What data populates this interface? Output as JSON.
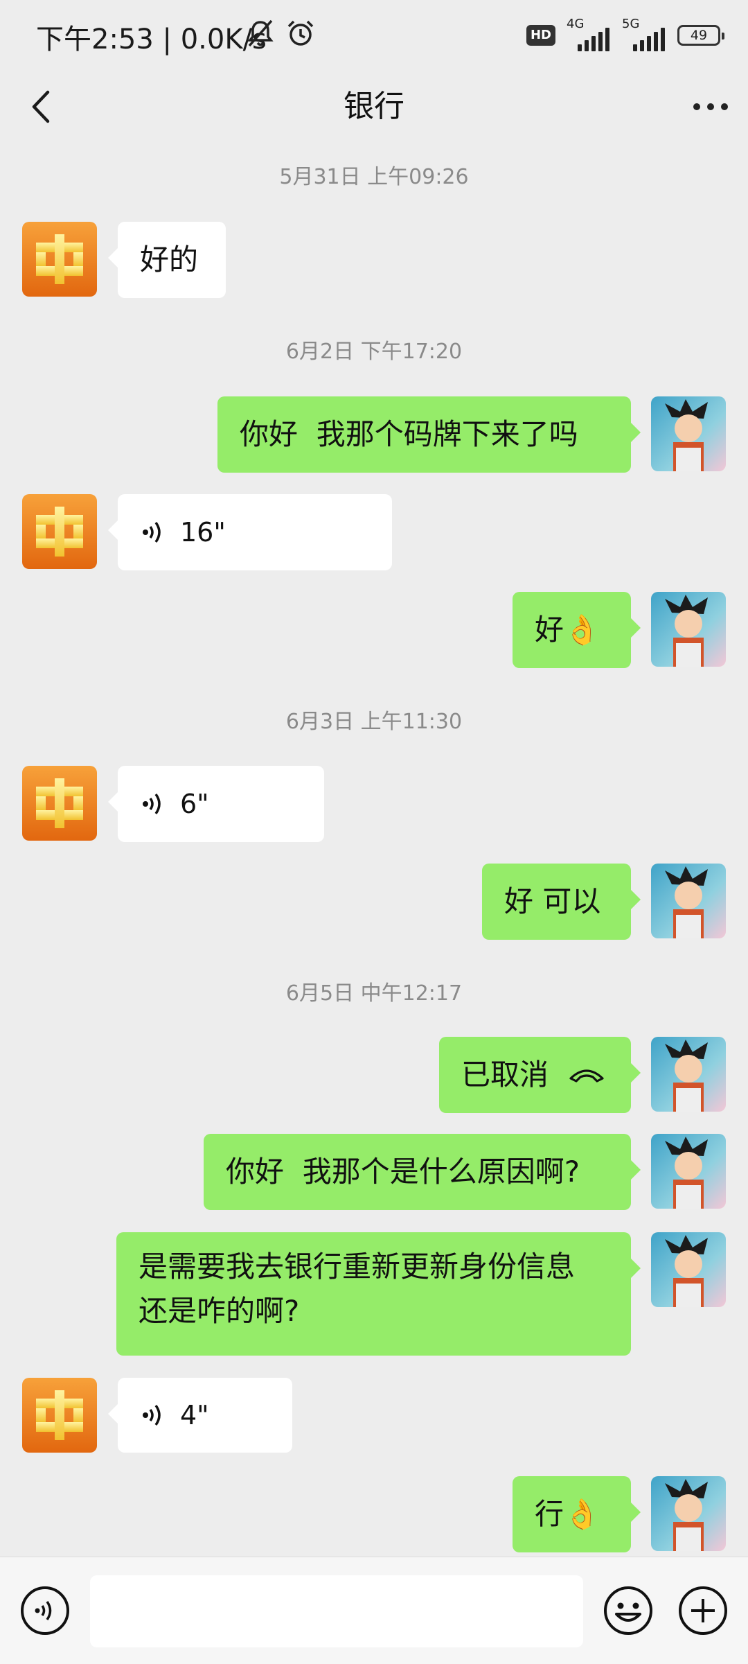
{
  "status_bar": {
    "time": "下午2:53 | 0.0K/s",
    "hd_label": "HD",
    "net1_label": "4G",
    "net2_label": "5G",
    "battery": "49"
  },
  "header": {
    "title": "银行",
    "back_icon": "chevron-left-icon",
    "more_icon": "more-dots-icon"
  },
  "messages": [
    {
      "type": "timestamp",
      "text": "5月31日 上午09:26"
    },
    {
      "type": "text",
      "side": "in",
      "text": "好的"
    },
    {
      "type": "timestamp",
      "text": "6月2日 下午17:20"
    },
    {
      "type": "text",
      "side": "out",
      "text": "你好  我那个码牌下来了吗"
    },
    {
      "type": "voice",
      "side": "in",
      "duration": "16\""
    },
    {
      "type": "text",
      "side": "out",
      "text": "好👌"
    },
    {
      "type": "timestamp",
      "text": "6月3日 上午11:30"
    },
    {
      "type": "voice",
      "side": "in",
      "duration": "6\""
    },
    {
      "type": "text",
      "side": "out",
      "text": "好 可以"
    },
    {
      "type": "timestamp",
      "text": "6月5日 中午12:17"
    },
    {
      "type": "call",
      "side": "out",
      "text": "已取消"
    },
    {
      "type": "text",
      "side": "out",
      "text": "你好  我那个是什么原因啊?"
    },
    {
      "type": "text",
      "side": "out",
      "text": "是需要我去银行重新更新身份信息\n还是咋的啊?"
    },
    {
      "type": "voice",
      "side": "in",
      "duration": "4\""
    },
    {
      "type": "text",
      "side": "out",
      "text": "行👌"
    }
  ],
  "input_bar": {
    "voice_icon": "voice-mode-icon",
    "placeholder": "",
    "emoji_icon": "emoji-icon",
    "plus_icon": "plus-icon"
  },
  "colors": {
    "background": "#ededed",
    "outgoing_bubble": "#95ec69",
    "incoming_bubble": "#ffffff",
    "timestamp": "#8a8a8a"
  }
}
